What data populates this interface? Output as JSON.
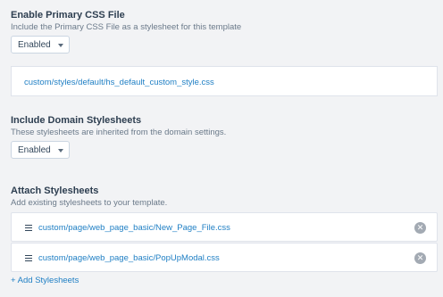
{
  "primary_css": {
    "title": "Enable Primary CSS File",
    "help": "Include the Primary CSS File as a stylesheet for this template",
    "select_value": "Enabled",
    "file_path": "custom/styles/default/hs_default_custom_style.css"
  },
  "domain_stylesheets": {
    "title": "Include Domain Stylesheets",
    "help": "These stylesheets are inherited from the domain settings.",
    "select_value": "Enabled"
  },
  "attach_stylesheets": {
    "title": "Attach Stylesheets",
    "help": "Add existing stylesheets to your template.",
    "items": [
      {
        "path": "custom/page/web_page_basic/New_Page_File.css"
      },
      {
        "path": "custom/page/web_page_basic/PopUpModal.css"
      }
    ],
    "add_label": "+ Add Stylesheets"
  },
  "icons": {
    "drag": "drag-handle-icon",
    "remove": "close-icon",
    "dropdown": "chevron-down-icon"
  },
  "colors": {
    "link": "#1f7fc4",
    "background": "#f2f3f5",
    "remove_button": "#a3aab3"
  }
}
